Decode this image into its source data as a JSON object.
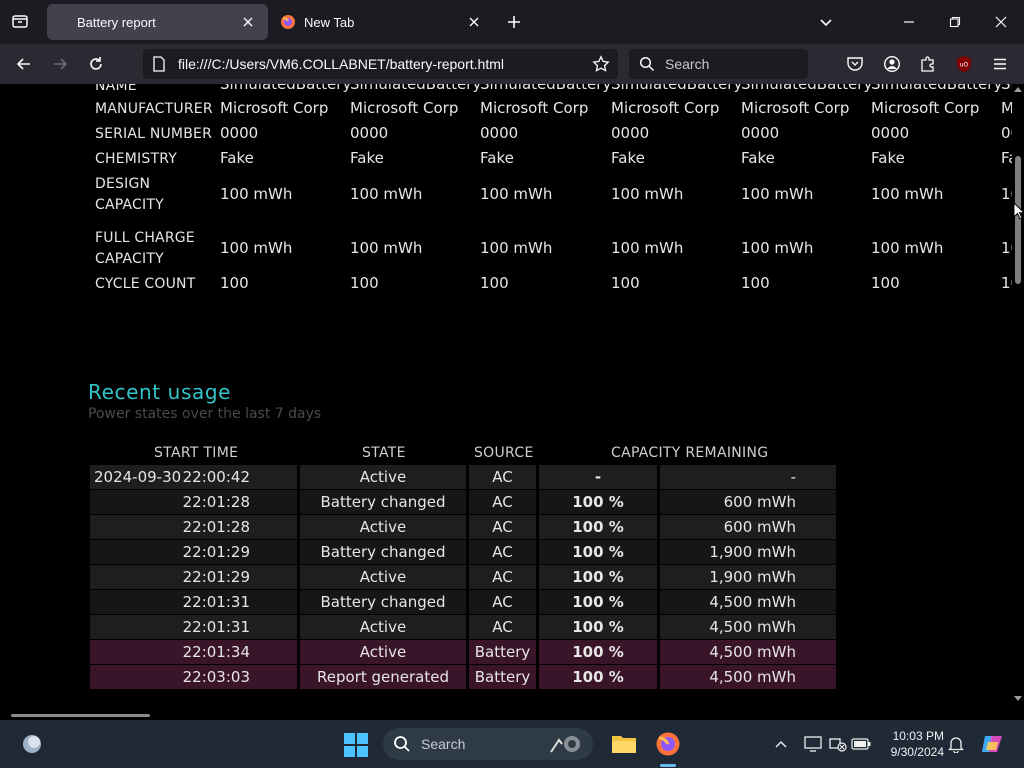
{
  "browser": {
    "tabs": [
      {
        "label": "Battery report",
        "active": true
      },
      {
        "label": "New Tab",
        "active": false
      }
    ],
    "url": "file:///C:/Users/VM6.COLLABNET/battery-report.html",
    "search_placeholder": "Search",
    "accent": "#42414d"
  },
  "installed_batteries": {
    "partial_top_label": "NAME",
    "partial_top_value": "SimulatedBattery",
    "rows": [
      {
        "label": "MANUFACTURER",
        "value": "Microsoft Corp"
      },
      {
        "label": "SERIAL NUMBER",
        "value": "0000"
      },
      {
        "label": "CHEMISTRY",
        "value": "Fake"
      },
      {
        "label": "DESIGN CAPACITY",
        "label_l1": "DESIGN",
        "label_l2": "CAPACITY",
        "value": "100 mWh"
      },
      {
        "label": "FULL CHARGE CAPACITY",
        "label_l1": "FULL CHARGE",
        "label_l2": "CAPACITY",
        "value": "100 mWh"
      },
      {
        "label": "CYCLE COUNT",
        "value": "100"
      }
    ],
    "columns_visible": 7
  },
  "recent_usage": {
    "title": "Recent usage",
    "subtitle": "Power states over the last 7 days",
    "headers": [
      "START TIME",
      "STATE",
      "SOURCE",
      "CAPACITY REMAINING"
    ],
    "rows": [
      {
        "date": "2024-09-30",
        "time": "22:00:42",
        "state": "Active",
        "source": "AC",
        "percent": "-",
        "mwh": "-"
      },
      {
        "date": "",
        "time": "22:01:28",
        "state": "Battery changed",
        "source": "AC",
        "percent": "100 %",
        "mwh": "600 mWh"
      },
      {
        "date": "",
        "time": "22:01:28",
        "state": "Active",
        "source": "AC",
        "percent": "100 %",
        "mwh": "600 mWh"
      },
      {
        "date": "",
        "time": "22:01:29",
        "state": "Battery changed",
        "source": "AC",
        "percent": "100 %",
        "mwh": "1,900 mWh"
      },
      {
        "date": "",
        "time": "22:01:29",
        "state": "Active",
        "source": "AC",
        "percent": "100 %",
        "mwh": "1,900 mWh"
      },
      {
        "date": "",
        "time": "22:01:31",
        "state": "Battery changed",
        "source": "AC",
        "percent": "100 %",
        "mwh": "4,500 mWh"
      },
      {
        "date": "",
        "time": "22:01:31",
        "state": "Active",
        "source": "AC",
        "percent": "100 %",
        "mwh": "4,500 mWh"
      },
      {
        "date": "",
        "time": "22:01:34",
        "state": "Active",
        "source": "Battery",
        "percent": "100 %",
        "mwh": "4,500 mWh"
      },
      {
        "date": "",
        "time": "22:03:03",
        "state": "Report generated",
        "source": "Battery",
        "percent": "100 %",
        "mwh": "4,500 mWh"
      }
    ]
  },
  "taskbar": {
    "search_placeholder": "Search",
    "time": "10:03 PM",
    "date": "9/30/2024"
  }
}
